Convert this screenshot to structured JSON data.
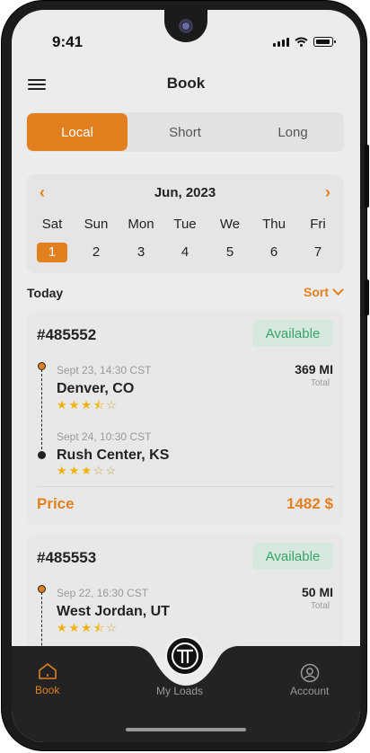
{
  "status_bar": {
    "time": "9:41"
  },
  "header": {
    "title": "Book",
    "menu_icon": "menu-icon"
  },
  "segments": {
    "items": [
      "Local",
      "Short",
      "Long"
    ],
    "active": "Local"
  },
  "calendar": {
    "month": "Jun, 2023",
    "weekdays": [
      "Sat",
      "Sun",
      "Mon",
      "Tue",
      "We",
      "Thu",
      "Fri"
    ],
    "days": [
      "1",
      "2",
      "3",
      "4",
      "5",
      "6",
      "7"
    ],
    "selected_day": "1"
  },
  "list_header": {
    "title": "Today",
    "sort_label": "Sort"
  },
  "loads": [
    {
      "id": "#485552",
      "status": "Available",
      "origin": {
        "date": "Sept 23, 14:30 CST",
        "city": "Denver, CO",
        "rating": 3.5
      },
      "destination": {
        "date": "Sept 24, 10:30 CST",
        "city": "Rush Center, KS",
        "rating": 3
      },
      "distance": "369 MI",
      "distance_label": "Total",
      "price_label": "Price",
      "price": "1482 $"
    },
    {
      "id": "#485553",
      "status": "Available",
      "origin": {
        "date": "Sep 22, 16:30 CST",
        "city": "West Jordan, UT",
        "rating": 3.5
      },
      "distance": "50 MI",
      "distance_label": "Total"
    }
  ],
  "tab_bar": {
    "items": [
      {
        "label": "Book",
        "icon": "home-icon",
        "active": true
      },
      {
        "label": "My Loads",
        "icon": "logo-icon",
        "active": false
      },
      {
        "label": "Account",
        "icon": "user-icon",
        "active": false
      }
    ]
  },
  "colors": {
    "accent": "#e2801f",
    "available": "#3aa56a",
    "star": "#f2b100"
  }
}
